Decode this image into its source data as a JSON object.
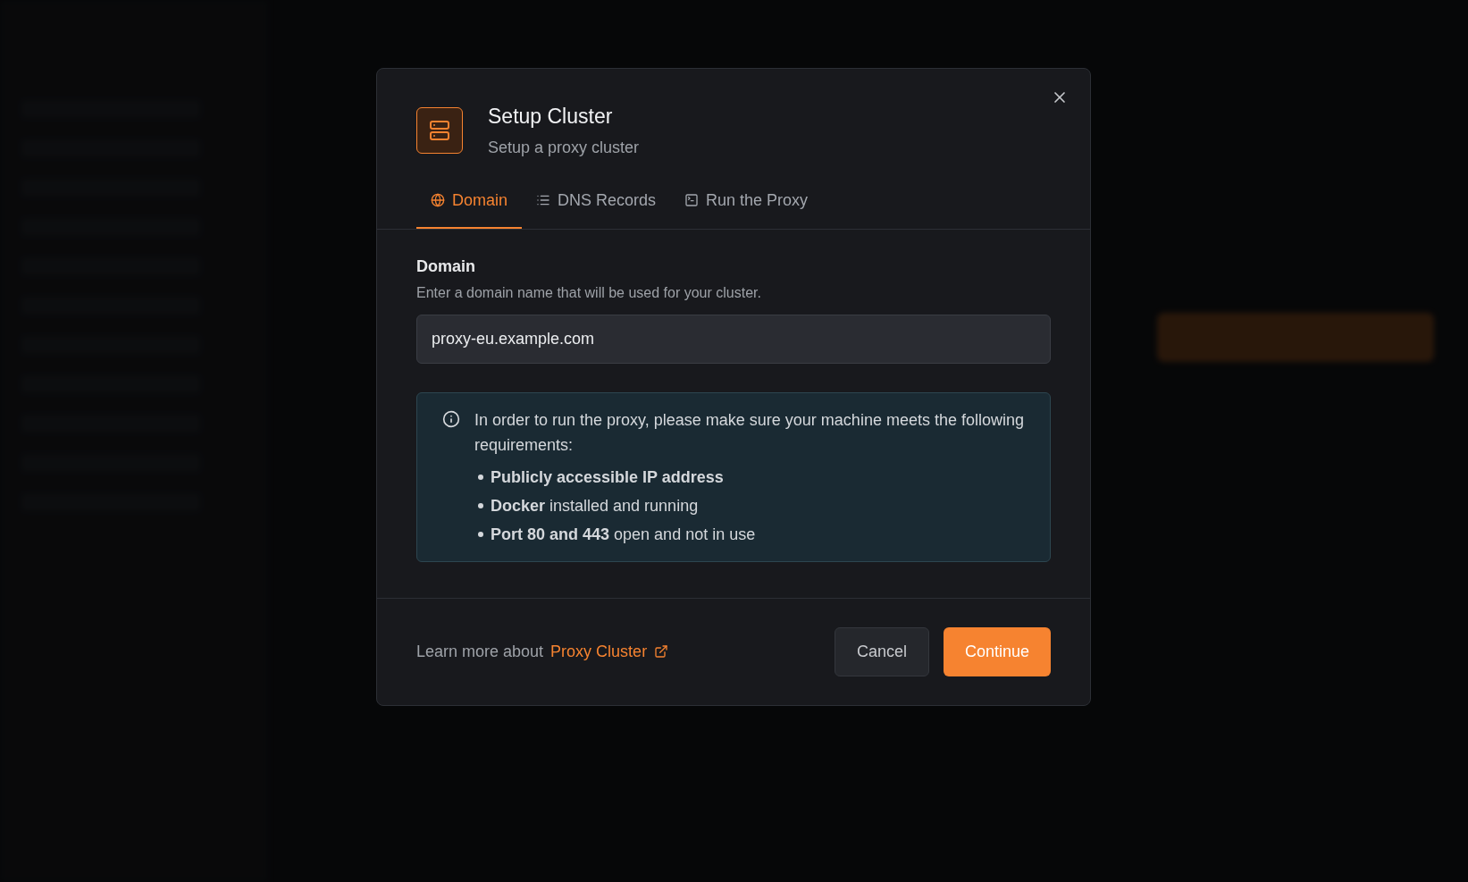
{
  "dialog": {
    "title": "Setup Cluster",
    "subtitle": "Setup a proxy cluster",
    "tabs": [
      {
        "label": "Domain",
        "selected": true,
        "kind": "globe"
      },
      {
        "label": "DNS Records",
        "selected": false,
        "kind": "list"
      },
      {
        "label": "Run the Proxy",
        "selected": false,
        "kind": "terminal"
      }
    ],
    "field": {
      "label": "Domain",
      "help": "Enter a domain name that will be used for your cluster.",
      "value": "proxy-eu.example.com"
    },
    "notice": {
      "text": "In order to run the proxy, please make sure your machine meets the following requirements:",
      "items": [
        "**Publicly accessible IP address**",
        "**Docker** installed and running",
        "**Port 80 and 443** open and not in use"
      ]
    },
    "footer": {
      "text": "Learn more about",
      "link": "Proxy Cluster"
    },
    "buttons": [
      {
        "label": "Cancel",
        "kind": "secondary"
      },
      {
        "label": "Continue",
        "kind": "primary"
      }
    ]
  }
}
